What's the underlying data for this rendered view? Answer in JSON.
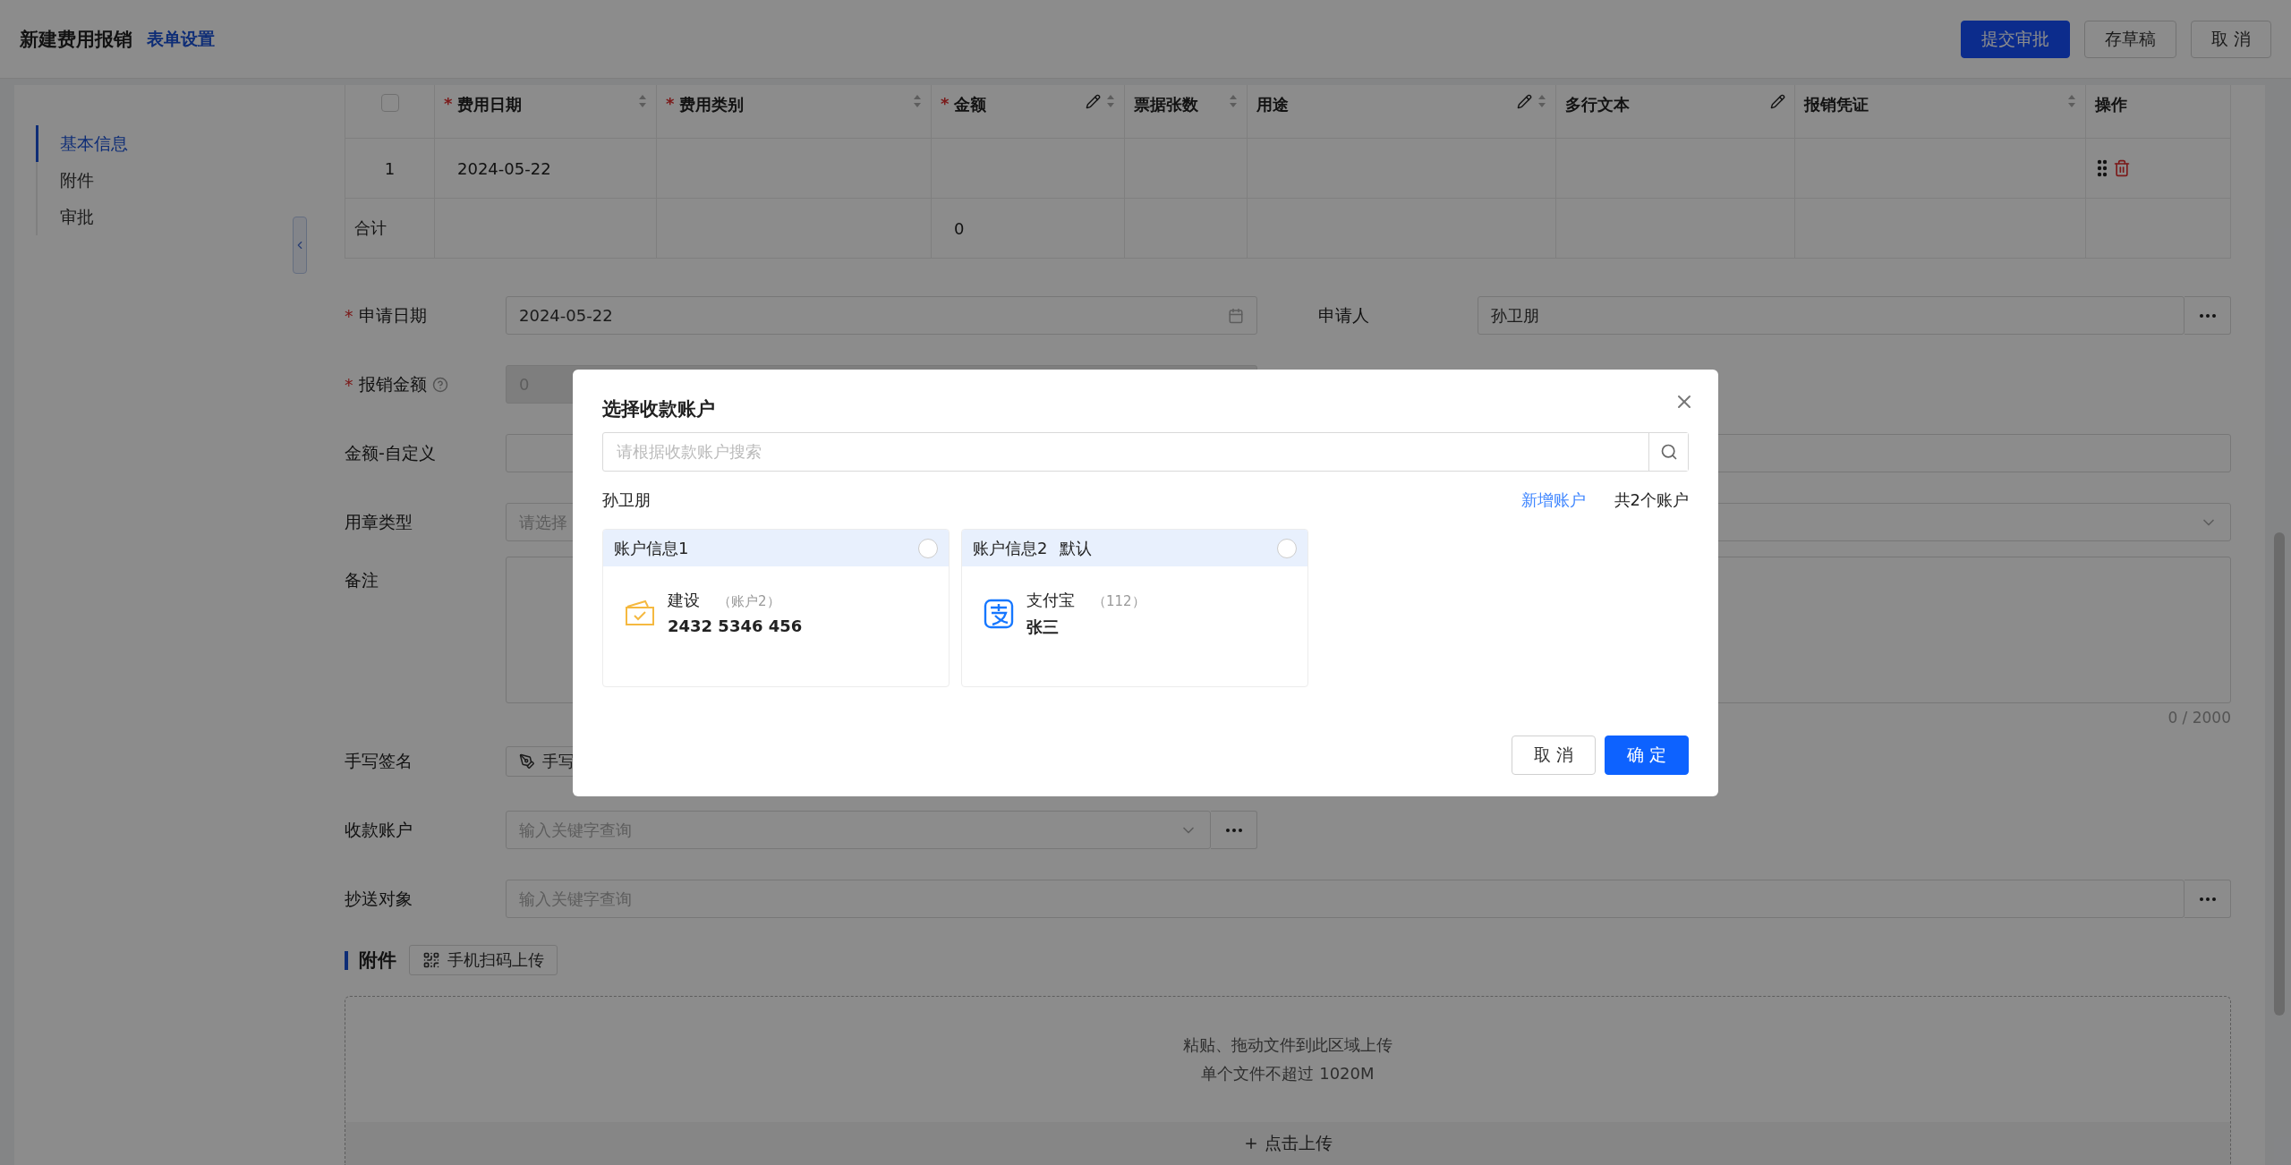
{
  "header": {
    "title": "新建费用报销",
    "link": "表单设置",
    "buttons": [
      {
        "label": "提交审批",
        "kind": "primary"
      },
      {
        "label": "存草稿",
        "kind": "default"
      },
      {
        "label": "取 消",
        "kind": "default"
      }
    ]
  },
  "nav": {
    "items": [
      {
        "label": "基本信息",
        "selected": true
      },
      {
        "label": "附件",
        "selected": false
      },
      {
        "label": "审批",
        "selected": false
      }
    ]
  },
  "table": {
    "select_all": {
      "checked": false
    },
    "columns": [
      {
        "label": "费用日期",
        "marker": "*",
        "sortable": true,
        "editable": false
      },
      {
        "label": "费用类别",
        "marker": "*",
        "sortable": true,
        "editable": false
      },
      {
        "label": "金额",
        "marker": "*",
        "sortable": true,
        "editable": true
      },
      {
        "label": "票据张数",
        "sortable": true,
        "editable": false
      },
      {
        "label": "用途",
        "sortable": true,
        "editable": true
      },
      {
        "label": "多行文本",
        "sortable": false,
        "editable": true
      },
      {
        "label": "报销凭证",
        "sortable": true,
        "editable": false
      },
      {
        "label": "操作",
        "sortable": false,
        "editable": false
      }
    ],
    "rows": [
      {
        "index": "1",
        "expense_date": "2024-05-22"
      }
    ],
    "total": {
      "label": "合计",
      "amount": "0"
    }
  },
  "form": {
    "rows": [
      {
        "kind": "date",
        "label": "申请日期",
        "marker": "*",
        "value": "2024-05-22",
        "side": {
          "label": "申请人",
          "value": "孙卫朋"
        }
      },
      {
        "kind": "number",
        "label": "报销金额",
        "marker": "*",
        "help": true,
        "placeholder": "0",
        "disabled": true
      },
      {
        "kind": "text",
        "label": "金额-自定义"
      },
      {
        "kind": "select",
        "label": "用章类型",
        "placeholder": "请选择"
      },
      {
        "kind": "textarea",
        "label": "备注",
        "counter": "0 / 2000"
      },
      {
        "kind": "signature",
        "label": "手写签名",
        "button": "手写"
      },
      {
        "kind": "lookup",
        "label": "收款账户",
        "placeholder": "输入关键字查询"
      },
      {
        "kind": "lookup-wide",
        "label": "抄送对象",
        "placeholder": "输入关键字查询"
      }
    ]
  },
  "attachments": {
    "title": "附件",
    "scan_button": "手机扫码上传",
    "hint": "粘贴、拖动文件到此区域上传",
    "limit": "单个文件不超过 1020M",
    "upload": "点击上传"
  },
  "modal": {
    "title": "选择收款账户",
    "search_placeholder": "请根据收款账户搜索",
    "owner": "孙卫朋",
    "add_link": "新增账户",
    "count": "共2个账户",
    "accounts": [
      {
        "kind": "bank",
        "title": "账户信息1",
        "selected": false,
        "name": "建设",
        "note": "（账户2）",
        "detail": "2432 5346 456"
      },
      {
        "kind": "alipay",
        "title": "账户信息2",
        "tag": "默认",
        "selected": false,
        "name": "支付宝",
        "note": "（112）",
        "detail": "张三"
      }
    ],
    "buttons": [
      {
        "label": "取 消",
        "kind": "default"
      },
      {
        "label": "确 定",
        "kind": "primary"
      }
    ]
  }
}
